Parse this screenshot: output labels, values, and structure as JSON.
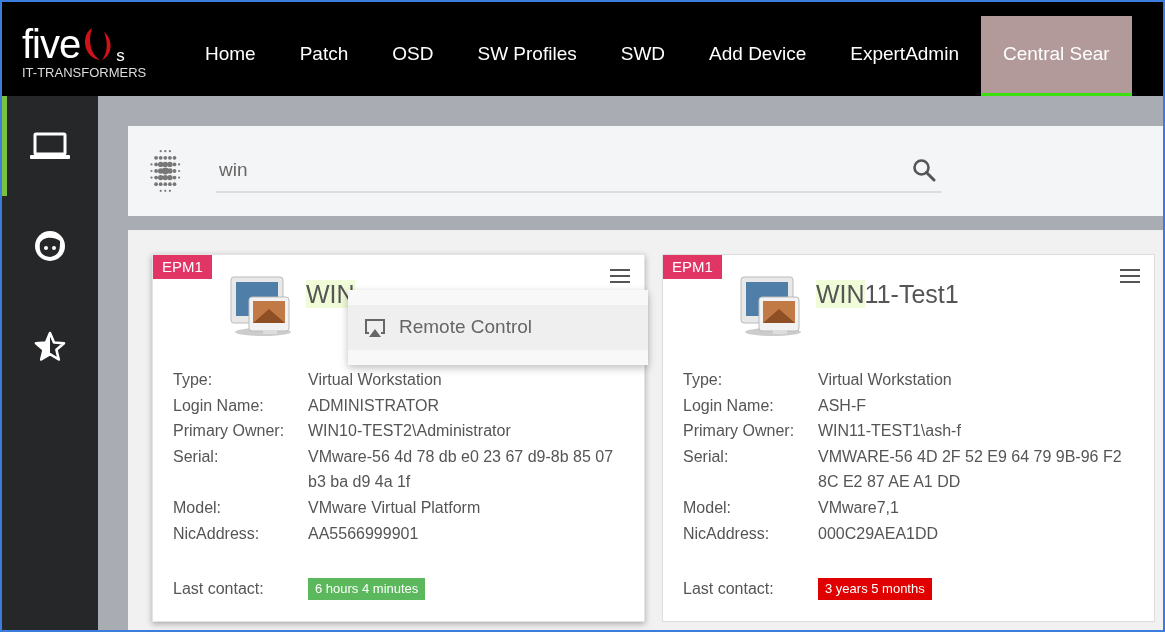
{
  "logo": {
    "word": "five",
    "suffix": "s",
    "tagline": "IT-TRANSFORMERS"
  },
  "nav": [
    {
      "label": "Home",
      "selected": false
    },
    {
      "label": "Patch",
      "selected": false
    },
    {
      "label": "OSD",
      "selected": false
    },
    {
      "label": "SW Profiles",
      "selected": false
    },
    {
      "label": "SWD",
      "selected": false
    },
    {
      "label": "Add Device",
      "selected": false
    },
    {
      "label": "ExpertAdmin",
      "selected": false
    },
    {
      "label": "Central Sear",
      "selected": true
    }
  ],
  "sidebar": {
    "items": [
      {
        "kind": "devices",
        "selected": true
      },
      {
        "kind": "users",
        "selected": false
      },
      {
        "kind": "favorites",
        "selected": false
      }
    ]
  },
  "search": {
    "value": "win"
  },
  "cards": [
    {
      "badge": "EPM1",
      "title_match": "WIN",
      "menu": {
        "items": [
          {
            "label": "Remote Control"
          }
        ]
      },
      "fields": [
        {
          "label": "Type:",
          "value": "Virtual Workstation"
        },
        {
          "label": "Login Name:",
          "value": "ADMINISTRATOR"
        },
        {
          "label": "Primary Owner:",
          "value": "WIN10-TEST2\\Administrator"
        },
        {
          "label": "Serial:",
          "value": "VMware-56 4d 78 db e0 23 67 d9-8b 85 07 b3 ba d9 4a 1f"
        },
        {
          "label": "Model:",
          "value": "VMware Virtual Platform"
        },
        {
          "label": "NicAddress:",
          "value": "AA5566999901"
        }
      ],
      "last_contact": {
        "label": "Last contact:",
        "value": "6 hours 4 minutes",
        "color": "#5cb85c"
      }
    },
    {
      "badge": "EPM1",
      "title_match": "WIN",
      "title_rest": "11-Test1",
      "fields": [
        {
          "label": "Type:",
          "value": "Virtual Workstation"
        },
        {
          "label": "Login Name:",
          "value": "ASH-F"
        },
        {
          "label": "Primary Owner:",
          "value": "WIN11-TEST1\\ash-f"
        },
        {
          "label": "Serial:",
          "value": "VMWARE-56 4D 2F 52 E9 64 79 9B-96 F2 8C E2 87 AE A1 DD"
        },
        {
          "label": "Model:",
          "value": "VMware7,1"
        },
        {
          "label": "NicAddress:",
          "value": "000C29AEA1DD"
        }
      ],
      "last_contact": {
        "label": "Last contact:",
        "value": "3 years 5 months",
        "color": "#e00000"
      }
    }
  ]
}
